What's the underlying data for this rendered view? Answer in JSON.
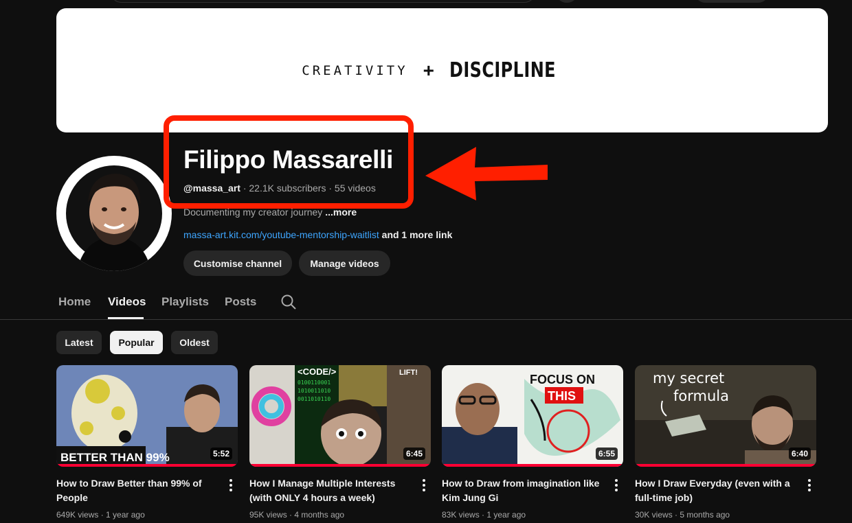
{
  "banner": {
    "left_text": "CREATIVITY",
    "plus": "+",
    "right_text": "DISCIPLINE"
  },
  "channel": {
    "name": "Filippo Massarelli",
    "handle": "@massa_art",
    "subscribers": "22.1K subscribers",
    "videos": "55 videos",
    "separator": " · ",
    "description": "Documenting my creator journey ",
    "more": "...more",
    "link": "massa-art.kit.com/youtube-mentorship-waitlist",
    "more_links": " and 1 more link"
  },
  "buttons": {
    "customise": "Customise channel",
    "manage": "Manage videos"
  },
  "tabs": [
    {
      "label": "Home"
    },
    {
      "label": "Videos",
      "active": true
    },
    {
      "label": "Playlists"
    },
    {
      "label": "Posts"
    }
  ],
  "chips": [
    {
      "label": "Latest"
    },
    {
      "label": "Popular",
      "selected": true
    },
    {
      "label": "Oldest"
    }
  ],
  "videos": [
    {
      "title": "How to Draw Better than 99% of People",
      "views": "649K views",
      "age": "1 year ago",
      "duration": "5:52",
      "thumb_text": "BETTER THAN 99%"
    },
    {
      "title": "How I Manage Multiple Interests (with ONLY 4 hours a week)",
      "views": "95K views",
      "age": "4 months ago",
      "duration": "6:45",
      "thumb_text": "<CODE/>",
      "thumb_text_2": "LIFT!"
    },
    {
      "title": "How to Draw from imagination like Kim Jung Gi",
      "views": "83K views",
      "age": "1 year ago",
      "duration": "6:55",
      "thumb_text": "FOCUS ON",
      "thumb_text_2": "THIS"
    },
    {
      "title": "How I Draw Everyday (even with a full-time job)",
      "views": "30K views",
      "age": "5 months ago",
      "duration": "6:40",
      "thumb_text": "my secret",
      "thumb_text_2": "formula"
    }
  ],
  "colors": {
    "accent_red": "#ff1f00",
    "progress_red": "#ff0033",
    "link_blue": "#3ea6ff",
    "background": "#0f0f0f"
  }
}
